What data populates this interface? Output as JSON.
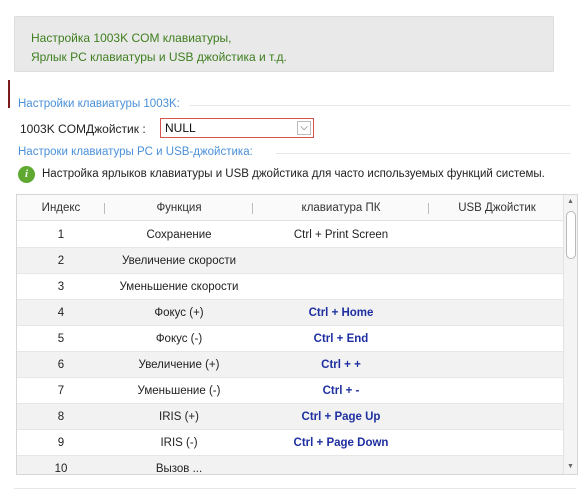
{
  "banner": {
    "line1": "Настройка 1003K COM клавиатуры,",
    "line2": "Ярлык PC клавиатуры и USB джойстика и т.д."
  },
  "keyboard_section": {
    "title": "Настройки клавиатуры 1003K:",
    "field_label": "1003K COMДжойстик :",
    "field_value": "NULL"
  },
  "shortcut_section": {
    "title": "Настроки клавиатуры PC и USB-джойстика:",
    "hint_icon": "info-icon",
    "hint_text": "Настройка ярлыков клавиатуры и USB джойстика для часто используемых функций системы."
  },
  "table": {
    "headers": [
      "Индекс",
      "Функция",
      "клавиатура ПК",
      "USB Джойстик"
    ],
    "rows": [
      {
        "index": "1",
        "function": "Сохранение",
        "pc": "Ctrl + Print Screen",
        "usb": "",
        "bold": false
      },
      {
        "index": "2",
        "function": "Увеличение скорости",
        "pc": "",
        "usb": "",
        "bold": false
      },
      {
        "index": "3",
        "function": "Уменьшение скорости",
        "pc": "",
        "usb": "",
        "bold": false
      },
      {
        "index": "4",
        "function": "Фокус (+)",
        "pc": "Ctrl + Home",
        "usb": "",
        "bold": true
      },
      {
        "index": "5",
        "function": "Фокус (-)",
        "pc": "Ctrl + End",
        "usb": "",
        "bold": true
      },
      {
        "index": "6",
        "function": "Увеличение (+)",
        "pc": "Ctrl + +",
        "usb": "",
        "bold": true
      },
      {
        "index": "7",
        "function": "Уменьшение (-)",
        "pc": "Ctrl + -",
        "usb": "",
        "bold": true
      },
      {
        "index": "8",
        "function": "IRIS (+)",
        "pc": "Ctrl + Page Up",
        "usb": "",
        "bold": true
      },
      {
        "index": "9",
        "function": "IRIS (-)",
        "pc": "Ctrl + Page Down",
        "usb": "",
        "bold": true
      },
      {
        "index": "10",
        "function": "Вызов ...",
        "pc": "",
        "usb": "",
        "bold": false
      }
    ]
  },
  "colors": {
    "banner_text": "#3e7e1e",
    "section_title": "#4a90d9",
    "key_bold": "#1e2fa0",
    "select_border": "#d9534f"
  }
}
